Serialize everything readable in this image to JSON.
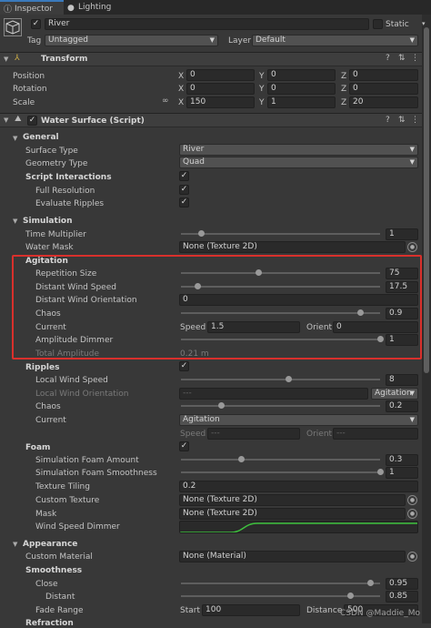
{
  "tabs": [
    {
      "label": "Inspector",
      "icon": "inspector-icon"
    },
    {
      "label": "Lighting",
      "icon": "light-bulb-icon"
    }
  ],
  "object": {
    "name": "River",
    "static_label": "Static",
    "tag_label": "Tag",
    "tag_value": "Untagged",
    "layer_label": "Layer",
    "layer_value": "Default"
  },
  "transform": {
    "title": "Transform",
    "rows": [
      {
        "label": "Position",
        "x": "0",
        "y": "0",
        "z": "0"
      },
      {
        "label": "Rotation",
        "x": "0",
        "y": "0",
        "z": "0"
      },
      {
        "label": "Scale",
        "x": "150",
        "y": "1",
        "z": "20"
      }
    ],
    "axis": {
      "x": "X",
      "y": "Y",
      "z": "Z"
    }
  },
  "water": {
    "title": "Water Surface (Script)",
    "general": {
      "title": "General",
      "surface_type_label": "Surface Type",
      "surface_type_value": "River",
      "geometry_type_label": "Geometry Type",
      "geometry_type_value": "Quad",
      "script_interactions_label": "Script Interactions",
      "full_resolution_label": "Full Resolution",
      "evaluate_ripples_label": "Evaluate Ripples"
    },
    "simulation": {
      "title": "Simulation",
      "time_multiplier_label": "Time Multiplier",
      "time_multiplier_value": "1",
      "time_multiplier_frac": 0.1,
      "water_mask_label": "Water Mask",
      "water_mask_value": "None (Texture 2D)"
    },
    "agitation": {
      "title": "Agitation",
      "repetition_size_label": "Repetition Size",
      "repetition_size_value": "75",
      "repetition_size_frac": 0.39,
      "distant_wind_speed_label": "Distant Wind Speed",
      "distant_wind_speed_value": "17.5",
      "distant_wind_speed_frac": 0.08,
      "distant_wind_orientation_label": "Distant Wind Orientation",
      "distant_wind_orientation_value": "0",
      "chaos_label": "Chaos",
      "chaos_value": "0.9",
      "chaos_frac": 0.9,
      "current_label": "Current",
      "speed_label": "Speed",
      "speed_value": "1.5",
      "orient_label": "Orient",
      "orient_value": "0",
      "amplitude_dimmer_label": "Amplitude Dimmer",
      "amplitude_dimmer_value": "1",
      "amplitude_dimmer_frac": 1.0,
      "total_amplitude_label": "Total Amplitude",
      "total_amplitude_value": "0.21 m"
    },
    "ripples": {
      "title": "Ripples",
      "local_wind_speed_label": "Local Wind Speed",
      "local_wind_speed_value": "8",
      "local_wind_speed_frac": 0.54,
      "local_wind_orientation_label": "Local Wind Orientation",
      "local_wind_orientation_field": "---",
      "local_wind_orientation_mode": "Agitation",
      "chaos_label": "Chaos",
      "chaos_value": "0.2",
      "chaos_frac": 0.2,
      "current_label": "Current",
      "current_value": "Agitation",
      "speed_label": "Speed",
      "speed_value": "---",
      "orient_label": "Orient",
      "orient_value": "---"
    },
    "foam": {
      "title": "Foam",
      "sim_foam_amount_label": "Simulation Foam Amount",
      "sim_foam_amount_value": "0.3",
      "sim_foam_amount_frac": 0.3,
      "sim_foam_smoothness_label": "Simulation Foam Smoothness",
      "sim_foam_smoothness_value": "1",
      "sim_foam_smoothness_frac": 1.0,
      "texture_tiling_label": "Texture Tiling",
      "texture_tiling_value": "0.2",
      "custom_texture_label": "Custom Texture",
      "custom_texture_value": "None (Texture 2D)",
      "mask_label": "Mask",
      "mask_value": "None (Texture 2D)",
      "wind_speed_dimmer_label": "Wind Speed Dimmer"
    },
    "appearance": {
      "title": "Appearance",
      "custom_material_label": "Custom Material",
      "custom_material_value": "None (Material)",
      "smoothness_title": "Smoothness",
      "close_label": "Close",
      "close_value": "0.95",
      "close_frac": 0.95,
      "distant_label": "Distant",
      "distant_value": "0.85",
      "distant_frac": 0.85,
      "fade_range_label": "Fade Range",
      "start_label": "Start",
      "start_value": "100",
      "distance_label": "Distance",
      "distance_value": "500",
      "refraction_label": "Refraction"
    }
  },
  "watermark": "CSDN @Maddie_Mo",
  "colors": {
    "accent": "#3a79bb",
    "highlight": "#d9302c",
    "curve": "#3ec13e"
  }
}
